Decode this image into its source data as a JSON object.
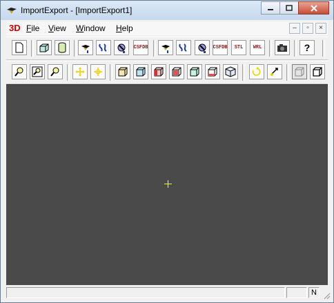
{
  "window": {
    "title": "ImportExport - [ImportExport1]"
  },
  "menubar": {
    "logo": "3D",
    "items": [
      "File",
      "View",
      "Window",
      "Help"
    ]
  },
  "toolbar1": {
    "buttons": [
      {
        "name": "new-document-button",
        "label": ""
      },
      {
        "name": "box-primitive-button",
        "label": ""
      },
      {
        "name": "cylinder-primitive-button",
        "label": ""
      },
      {
        "name": "import-brep-button",
        "label": ""
      },
      {
        "name": "import-iges-button",
        "label": ""
      },
      {
        "name": "import-step-button",
        "label": ""
      },
      {
        "name": "import-csfdb-button",
        "label": "CSFDB"
      },
      {
        "name": "export-brep-button",
        "label": ""
      },
      {
        "name": "export-iges-button",
        "label": ""
      },
      {
        "name": "export-step-button",
        "label": ""
      },
      {
        "name": "export-csfdb-button",
        "label": "CSFDB"
      },
      {
        "name": "export-stl-button",
        "label": "STL"
      },
      {
        "name": "export-wrl-button",
        "label": "WRL"
      },
      {
        "name": "capture-image-button",
        "label": ""
      },
      {
        "name": "help-button",
        "label": "?"
      }
    ]
  },
  "status": {
    "indicator": "N"
  },
  "colors": {
    "viewport_bg": "#4a4a4a",
    "crosshair": "#ffff00",
    "logo": "#d40000"
  }
}
